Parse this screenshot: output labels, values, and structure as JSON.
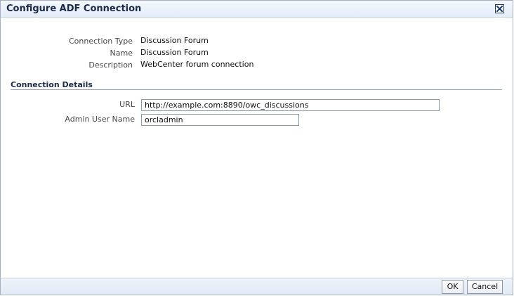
{
  "dialog": {
    "title": "Configure ADF Connection",
    "close_icon": "close-icon"
  },
  "info": {
    "connection_type_label": "Connection Type",
    "connection_type_value": "Discussion Forum",
    "name_label": "Name",
    "name_value": "Discussion Forum",
    "description_label": "Description",
    "description_value": "WebCenter forum connection"
  },
  "details": {
    "section_title": "Connection Details",
    "url_label": "URL",
    "url_value": "http://example.com:8890/owc_discussions",
    "admin_user_label": "Admin User Name",
    "admin_user_value": "orcladmin"
  },
  "footer": {
    "ok_label": "OK",
    "cancel_label": "Cancel"
  },
  "colors": {
    "title_text": "#1b2a4a",
    "titlebar_top": "#f4f8fd",
    "titlebar_bottom": "#e4ecf7",
    "close_border": "#1f3c70"
  }
}
